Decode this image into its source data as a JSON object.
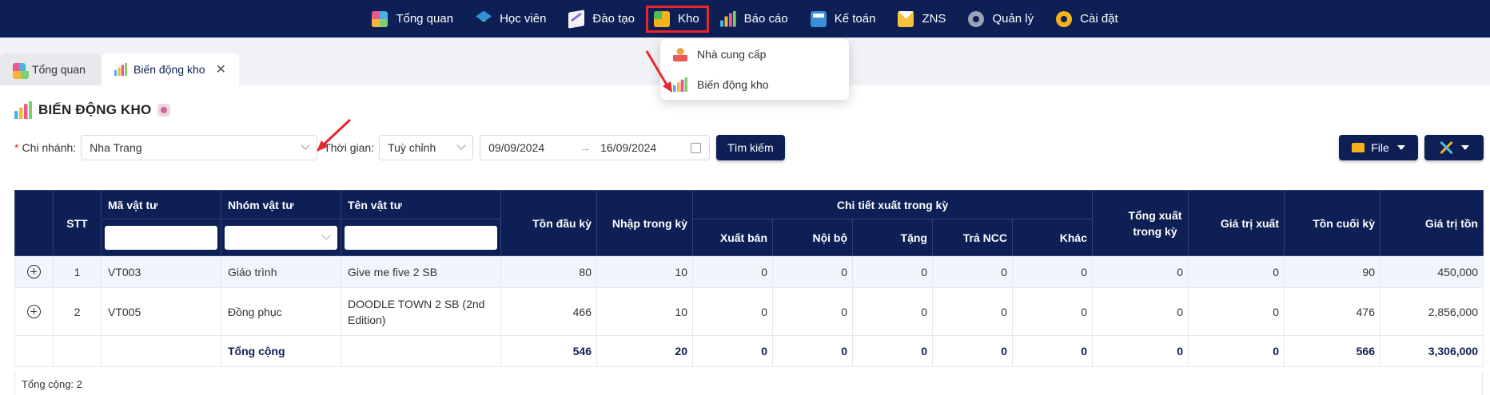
{
  "topnav": {
    "items": [
      {
        "label": "Tổng quan",
        "icon": "dashboard-grid-icon"
      },
      {
        "label": "Học viên",
        "icon": "graduation-cap-icon"
      },
      {
        "label": "Đào tạo",
        "icon": "pen-icon"
      },
      {
        "label": "Kho",
        "icon": "warehouse-box-icon"
      },
      {
        "label": "Báo cáo",
        "icon": "bar-chart-icon"
      },
      {
        "label": "Kế toán",
        "icon": "calculator-icon"
      },
      {
        "label": "ZNS",
        "icon": "mail-icon"
      },
      {
        "label": "Quản lý",
        "icon": "manage-gear-icon"
      },
      {
        "label": "Cài đặt",
        "icon": "settings-gear-icon"
      }
    ],
    "active_color": "#e8272c",
    "bg_color": "#0d1f55"
  },
  "dropdown": {
    "items": [
      {
        "label": "Nhà cung cấp",
        "icon": "supplier-person-icon"
      },
      {
        "label": "Biến động kho",
        "icon": "chart-icon"
      }
    ]
  },
  "tabs": [
    {
      "label": "Tổng quan"
    },
    {
      "label": "Biến động kho"
    }
  ],
  "page": {
    "title": "BIẾN ĐỘNG KHO"
  },
  "filters": {
    "branch_label": "Chi nhánh:",
    "branch_required": "*",
    "branch_value": "Nha Trang",
    "time_label": "Thời gian:",
    "time_value": "Tuỳ chỉnh",
    "date_from": "09/09/2024",
    "date_to": "16/09/2024",
    "date_sep": "→",
    "search_button": "Tìm kiếm"
  },
  "actions": {
    "file_button": "File"
  },
  "table": {
    "headers": {
      "stt": "STT",
      "code": "Mã vật tư",
      "group": "Nhóm vật tư",
      "name": "Tên vật tư",
      "opening": "Tồn đầu kỳ",
      "import": "Nhập trong kỳ",
      "export_detail": "Chi tiết xuất trong kỳ",
      "sale": "Xuất bán",
      "internal": "Nội bộ",
      "gift": "Tặng",
      "return_ncc": "Trả NCC",
      "other": "Khác",
      "total_export": "Tổng xuất trong kỳ",
      "export_value": "Giá trị xuất",
      "closing": "Tồn cuối kỳ",
      "stock_value": "Giá trị tồn"
    },
    "rows": [
      {
        "stt": "1",
        "code": "VT003",
        "group": "Giáo trình",
        "name": "Give me five 2 SB",
        "opening": "80",
        "import": "10",
        "sale": "0",
        "internal": "0",
        "gift": "0",
        "return_ncc": "0",
        "other": "0",
        "total_export": "0",
        "export_value": "0",
        "closing": "90",
        "stock_value": "450,000"
      },
      {
        "stt": "2",
        "code": "VT005",
        "group": "Đồng phục",
        "name": "DOODLE TOWN 2 SB (2nd Edition)",
        "opening": "466",
        "import": "10",
        "sale": "0",
        "internal": "0",
        "gift": "0",
        "return_ncc": "0",
        "other": "0",
        "total_export": "0",
        "export_value": "0",
        "closing": "476",
        "stock_value": "2,856,000"
      }
    ],
    "total": {
      "label": "Tổng cộng",
      "opening": "546",
      "import": "20",
      "sale": "0",
      "internal": "0",
      "gift": "0",
      "return_ncc": "0",
      "other": "0",
      "total_export": "0",
      "export_value": "0",
      "closing": "566",
      "stock_value": "3,306,000"
    },
    "footer": "Tổng cộng: 2"
  }
}
